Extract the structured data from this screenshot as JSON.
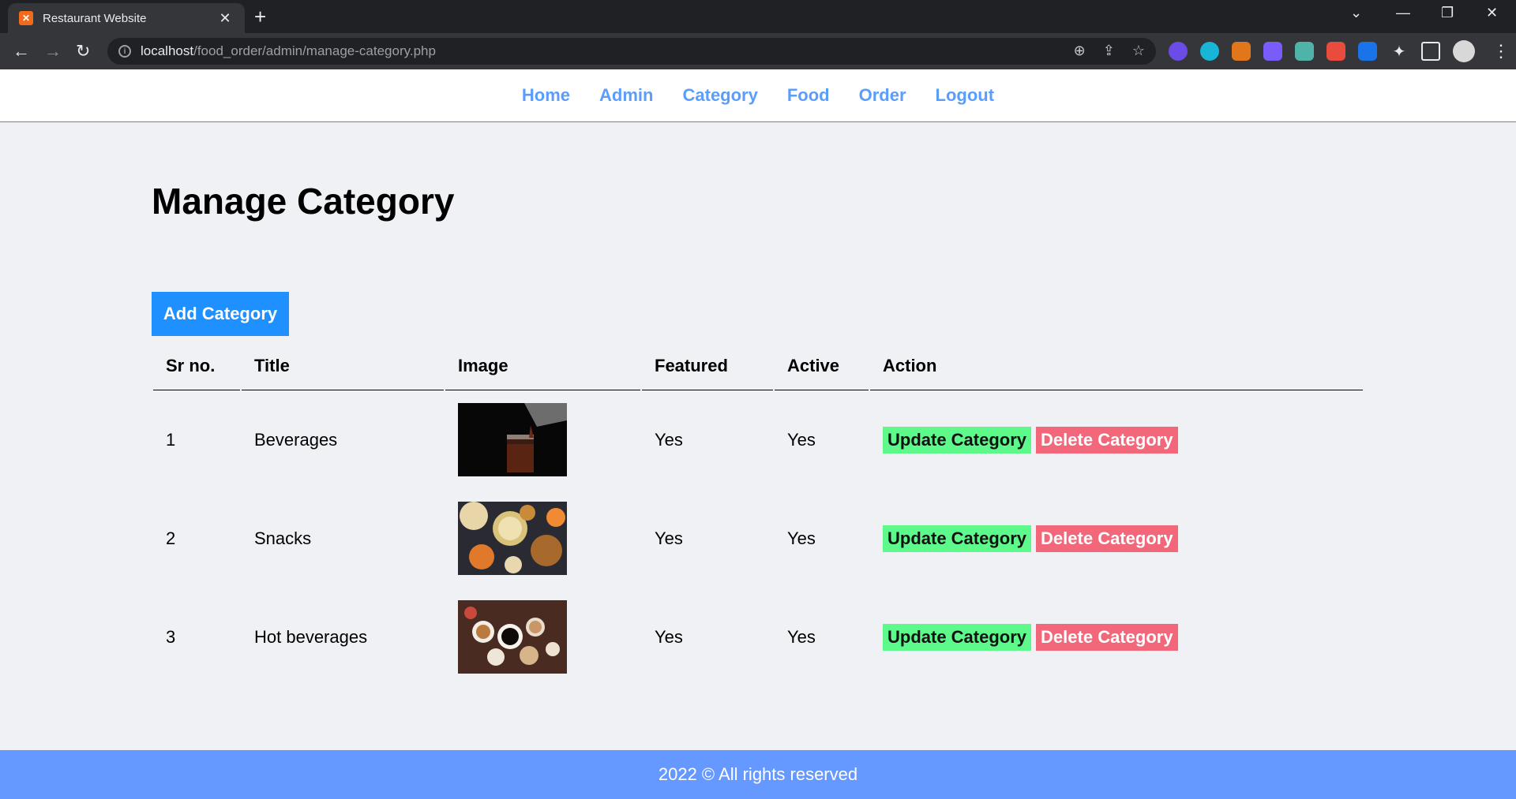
{
  "browser": {
    "tab_title": "Restaurant Website",
    "url_host": "localhost",
    "url_path": "/food_order/admin/manage-category.php"
  },
  "menu": {
    "items": [
      "Home",
      "Admin",
      "Category",
      "Food",
      "Order",
      "Logout"
    ]
  },
  "page_title": "Manage Category",
  "add_button": "Add Category",
  "table": {
    "headers": [
      "Sr no.",
      "Title",
      "Image",
      "Featured",
      "Active",
      "Action"
    ],
    "rows": [
      {
        "sr": "1",
        "title": "Beverages",
        "image": "beverages-image",
        "featured": "Yes",
        "active": "Yes",
        "update": "Update Category",
        "delete": "Delete Category"
      },
      {
        "sr": "2",
        "title": "Snacks",
        "image": "snacks-image",
        "featured": "Yes",
        "active": "Yes",
        "update": "Update Category",
        "delete": "Delete Category"
      },
      {
        "sr": "3",
        "title": "Hot beverages",
        "image": "hot-beverages-image",
        "featured": "Yes",
        "active": "Yes",
        "update": "Update Category",
        "delete": "Delete Category"
      }
    ]
  },
  "footer": "2022 © All rights reserved",
  "colors": {
    "nav_link": "#5a9dfb",
    "add_button": "#1e90ff",
    "update_button": "#5dfa8b",
    "delete_button": "#f2687a",
    "footer_bg": "#6699ff",
    "page_bg": "#f0f1f5"
  }
}
